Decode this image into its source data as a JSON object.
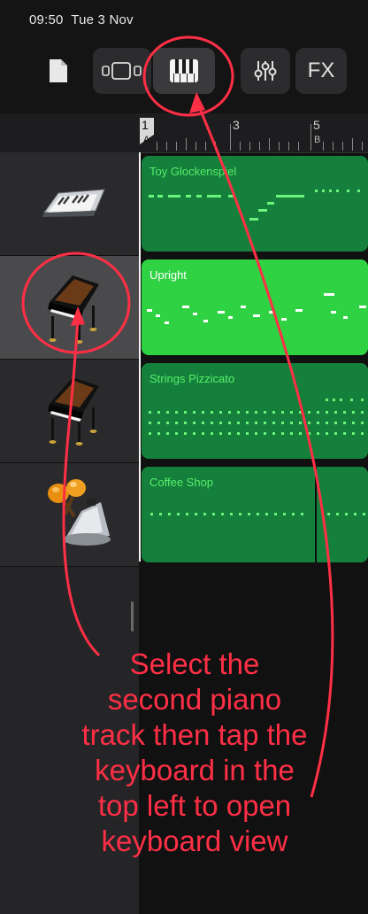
{
  "status_bar": {
    "time": "09:50",
    "date": "Tue 3 Nov"
  },
  "toolbar": {
    "buttons": [
      {
        "name": "my-songs",
        "icon": "document-icon"
      },
      {
        "name": "view-toggle",
        "icon": "tracks-view-icon"
      },
      {
        "name": "keyboard-view",
        "icon": "piano-keyboard-icon",
        "selected": true
      },
      {
        "name": "mixer",
        "icon": "mixer-sliders-icon"
      },
      {
        "name": "fx",
        "label": "FX"
      }
    ]
  },
  "ruler": {
    "bar_numbers": [
      "1",
      "3",
      "5"
    ],
    "section_letters": [
      "A",
      "B"
    ]
  },
  "tracks": [
    {
      "instrument_icon": "keyboard-synth-icon",
      "region_name": "Toy Glockenspiel",
      "selected": false
    },
    {
      "instrument_icon": "grand-piano-icon",
      "region_name": "Upright",
      "selected": true
    },
    {
      "instrument_icon": "grand-piano-icon",
      "region_name": "Strings Pizzicato",
      "selected": false
    },
    {
      "instrument_icon": "maracas-cowbell-icon",
      "region_name": "Coffee Shop",
      "selected": false
    }
  ],
  "annotation": {
    "color": "#ff2f46",
    "lines": [
      "Select the",
      "second piano",
      "track then tap the",
      "keyboard in the",
      "top left to open",
      "keyboard view"
    ]
  },
  "colors": {
    "region_green": "#15803c",
    "region_selected": "#2fd243",
    "region_text": "#56ee6a"
  }
}
